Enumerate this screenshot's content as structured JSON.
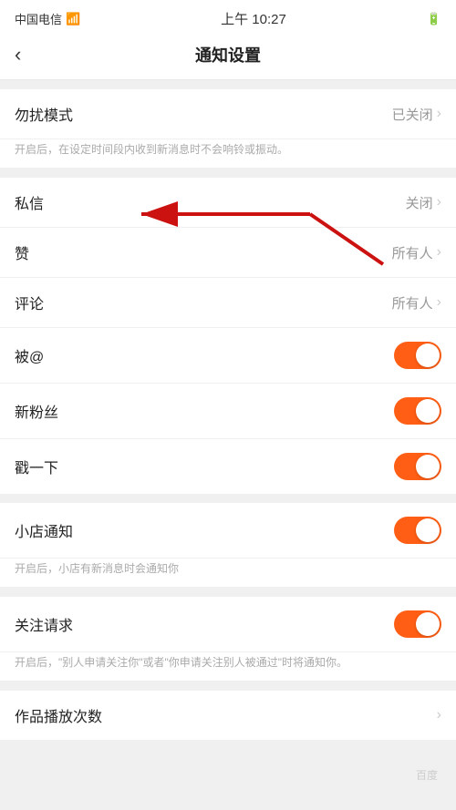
{
  "statusBar": {
    "carrier": "中国电信",
    "time": "上午 10:27",
    "batteryIcon": "▮"
  },
  "header": {
    "backLabel": "‹",
    "title": "通知设置"
  },
  "sections": [
    {
      "id": "dnd",
      "items": [
        {
          "id": "dnd-mode",
          "label": "勿扰模式",
          "valueText": "已关闭",
          "type": "link"
        }
      ],
      "hint": "开启后，在设定时间段内收到新消息时不会响铃或振动。"
    },
    {
      "id": "messages",
      "items": [
        {
          "id": "private-message",
          "label": "私信",
          "valueText": "关闭",
          "type": "link"
        },
        {
          "id": "like",
          "label": "赞",
          "valueText": "所有人",
          "type": "link"
        },
        {
          "id": "comment",
          "label": "评论",
          "valueText": "所有人",
          "type": "link"
        },
        {
          "id": "at",
          "label": "被@",
          "type": "toggle",
          "toggleOn": true
        },
        {
          "id": "new-fans",
          "label": "新粉丝",
          "type": "toggle",
          "toggleOn": true
        },
        {
          "id": "shake",
          "label": "戳一下",
          "type": "toggle",
          "toggleOn": true
        }
      ]
    },
    {
      "id": "shop",
      "items": [
        {
          "id": "shop-notice",
          "label": "小店通知",
          "type": "toggle",
          "toggleOn": true
        }
      ],
      "hint": "开启后，小店有新消息时会通知你"
    },
    {
      "id": "follow",
      "items": [
        {
          "id": "follow-request",
          "label": "关注请求",
          "type": "toggle",
          "toggleOn": true
        }
      ],
      "hint": "开启后，\"别人申请关注你\"或者\"你申请关注别人被通过\"时将通知你。"
    },
    {
      "id": "playcount",
      "items": [
        {
          "id": "play-count",
          "label": "作品播放次数",
          "type": "link-only"
        }
      ]
    }
  ],
  "watermark": {
    "text": "百度"
  }
}
